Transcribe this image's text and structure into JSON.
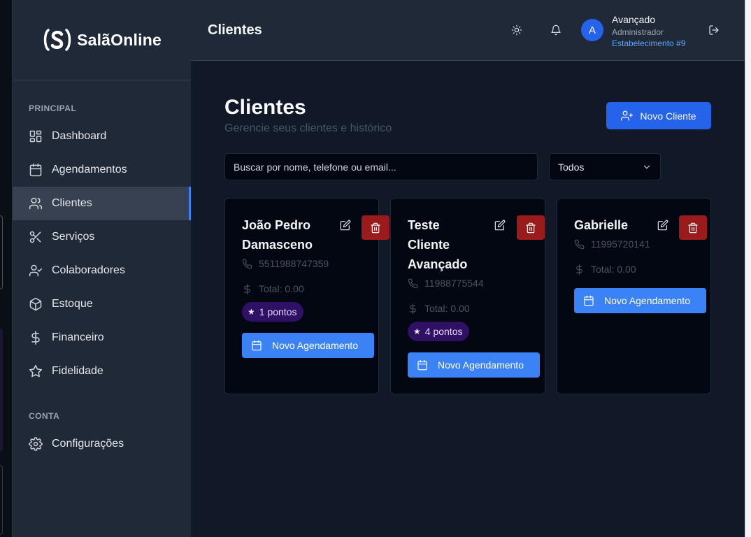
{
  "app": {
    "logo_text": "SalãOnline"
  },
  "sidebar": {
    "section_principal": "PRINCIPAL",
    "section_conta": "CONTA",
    "items": [
      {
        "label": "Dashboard",
        "icon": "dashboard-icon"
      },
      {
        "label": "Agendamentos",
        "icon": "calendar-icon"
      },
      {
        "label": "Clientes",
        "icon": "users-icon",
        "active": true
      },
      {
        "label": "Serviços",
        "icon": "scissors-icon"
      },
      {
        "label": "Colaboradores",
        "icon": "user-check-icon"
      },
      {
        "label": "Estoque",
        "icon": "box-icon"
      },
      {
        "label": "Financeiro",
        "icon": "dollar-icon"
      },
      {
        "label": "Fidelidade",
        "icon": "star-icon"
      }
    ],
    "settings_label": "Configurações"
  },
  "header": {
    "title": "Clientes",
    "user_initial": "A",
    "user_name": "Avançado",
    "user_role": "Administrador",
    "establishment": "Estabelecimento #9"
  },
  "main": {
    "title": "Clientes",
    "subtitle": "Gerencie seus clientes e histórico",
    "new_client_label": "Novo Cliente",
    "search_placeholder": "Buscar por nome, telefone ou email...",
    "filter_value": "Todos",
    "book_label": "Novo Agendamento",
    "clients": [
      {
        "name": "João Pedro Damasceno",
        "phone": "5511988747359",
        "total": "Total: 0.00",
        "points": "1 pontos"
      },
      {
        "name": "Teste Cliente Avançado",
        "phone": "11988775544",
        "total": "Total: 0.00",
        "points": "4 pontos"
      },
      {
        "name": "Gabrielle",
        "phone": "11995720141",
        "total": "Total: 0.00"
      }
    ]
  },
  "colors": {
    "accent": "#2563eb",
    "danger": "#991b1b",
    "sidebar": "#1f2937",
    "background": "#111827",
    "badge": "#2e1065"
  }
}
